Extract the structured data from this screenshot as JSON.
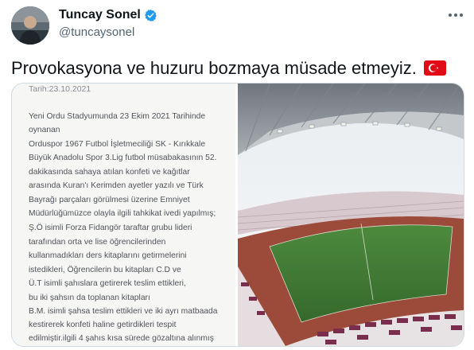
{
  "author": {
    "display_name": "Tuncay Sonel",
    "handle": "@tuncaysonel",
    "verified_icon": "verified-badge-icon",
    "avatar_icon": "profile-photo"
  },
  "more_icon": "more-options-icon",
  "tweet": {
    "text": "Provokasyona ve huzuru bozmaya müsade etmeyiz.",
    "emoji": "turkey-flag-icon"
  },
  "media": {
    "document": {
      "date_fragment": "Tarih:23.10.2021",
      "lines": [
        "Yeni Ordu Stadyumunda 23 Ekim 2021 Tarihinde",
        "oynanan",
        "Orduspor 1967 Futbol İşletmeciliği SK - Kırıkkale",
        "Büyük Anadolu Spor 3.Lig futbol müsabakasının 52.",
        "dakikasında sahaya atılan konfeti ve kağıtlar",
        "arasında Kuran'ı Kerimden ayetler yazılı ve Türk",
        "Bayrağı parçaları görülmesi üzerine Emniyet",
        "Müdürlüğümüzce olayla ilgili tahkikat ivedi yapılmış;",
        "Ş.Ö isimli Forza Fidangör taraftar grubu lideri",
        "tarafından orta ve lise öğrencilerinden",
        "kullanmadıkları ders kitaplarını getirmelerini",
        "istedikleri, Öğrencilerin bu kitapları C.D ve",
        "Ü.T isimli şahıslara getirerek teslim ettikleri,",
        "bu iki şahsın da toplanan kitapları",
        "B.M. isimli şahsa teslim ettikleri ve iki ayrı matbaada",
        "kestirerek konfeti haline getirdikleri tespit",
        "edilmiştir.ilgili 4 şahıs kısa sürede gözaltına alınmış"
      ]
    },
    "photo_icon": "stadium-photo"
  },
  "colors": {
    "text": "#0f1419",
    "muted": "#536471",
    "verified": "#1d9bf0",
    "flag_red": "#e30a17",
    "seat_maroon": "#7a2e4d",
    "pitch_green": "#3f7a34",
    "track_red": "#9c4a39"
  }
}
